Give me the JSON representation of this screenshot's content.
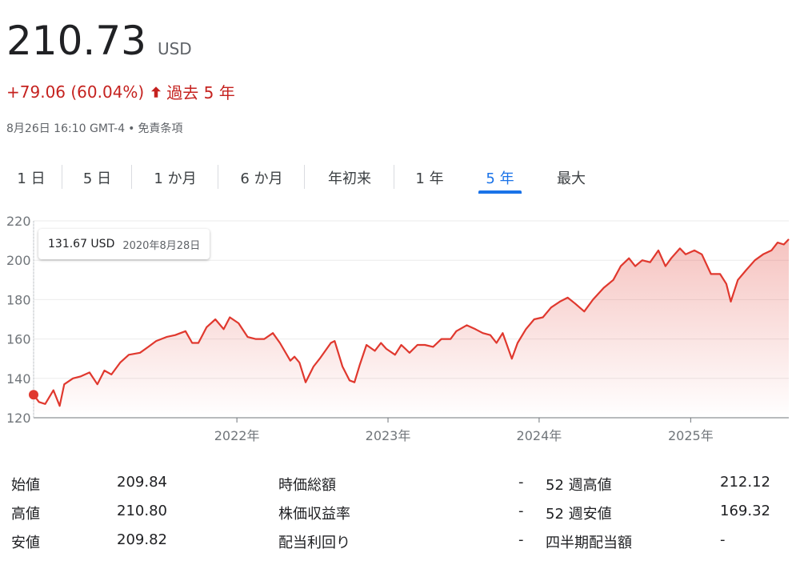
{
  "quote": {
    "price": "210.73",
    "currency": "USD",
    "change": "+79.06 (60.04%)",
    "period": "過去 5 年",
    "timestamp": "8月26日 16:10 GMT-4",
    "disclaimer": "免責条項"
  },
  "colors": {
    "accent": "#1a73e8",
    "negative_red": "#c5221f",
    "line": "#e0382e"
  },
  "tabs": [
    {
      "label": "1 日"
    },
    {
      "label": "5 日"
    },
    {
      "label": "1 か月"
    },
    {
      "label": "6 か月"
    },
    {
      "label": "年初来"
    },
    {
      "label": "1 年"
    },
    {
      "label": "5 年",
      "active": true
    },
    {
      "label": "最大"
    }
  ],
  "tooltip": {
    "value": "131.67 USD",
    "date": "2020年8月28日"
  },
  "chart_data": {
    "type": "area",
    "ylim": [
      120,
      220
    ],
    "yticks": [
      "220",
      "200",
      "180",
      "160",
      "140",
      "120"
    ],
    "xticks": [
      "2022年",
      "2023年",
      "2024年",
      "2025年"
    ],
    "grid": true,
    "series": [
      {
        "x": [
          "2020-08-28",
          "2020-09-10",
          "2020-09-25",
          "2020-10-15",
          "2020-10-30",
          "2020-11-10",
          "2020-12-01",
          "2020-12-20",
          "2021-01-10",
          "2021-01-29",
          "2021-02-15",
          "2021-03-04",
          "2021-03-25",
          "2021-04-15",
          "2021-05-12",
          "2021-06-01",
          "2021-06-20",
          "2021-07-15",
          "2021-08-05",
          "2021-08-30",
          "2021-09-15",
          "2021-09-30",
          "2021-10-20",
          "2021-11-10",
          "2021-11-30",
          "2021-12-15",
          "2022-01-05",
          "2022-01-27",
          "2022-02-15",
          "2022-03-08",
          "2022-03-29",
          "2022-04-15",
          "2022-05-10",
          "2022-05-20",
          "2022-06-01",
          "2022-06-16",
          "2022-07-05",
          "2022-07-20",
          "2022-08-16",
          "2022-08-25",
          "2022-09-13",
          "2022-09-30",
          "2022-10-12",
          "2022-10-25",
          "2022-11-10",
          "2022-11-30",
          "2022-12-15",
          "2022-12-28",
          "2023-01-18",
          "2023-02-02",
          "2023-02-22",
          "2023-03-13",
          "2023-03-31",
          "2023-04-20",
          "2023-05-10",
          "2023-06-01",
          "2023-06-15",
          "2023-07-10",
          "2023-07-31",
          "2023-08-18",
          "2023-09-05",
          "2023-09-20",
          "2023-10-05",
          "2023-10-27",
          "2023-11-10",
          "2023-11-30",
          "2023-12-20",
          "2024-01-10",
          "2024-01-30",
          "2024-02-20",
          "2024-03-10",
          "2024-03-28",
          "2024-04-19",
          "2024-05-10",
          "2024-06-05",
          "2024-06-28",
          "2024-07-16",
          "2024-08-05",
          "2024-08-20",
          "2024-09-06",
          "2024-09-25",
          "2024-10-15",
          "2024-11-01",
          "2024-11-15",
          "2024-12-06",
          "2024-12-20",
          "2025-01-10",
          "2025-01-28",
          "2025-02-19",
          "2025-03-13",
          "2025-03-28",
          "2025-04-08",
          "2025-04-25",
          "2025-05-15",
          "2025-06-05",
          "2025-06-25",
          "2025-07-15",
          "2025-07-30",
          "2025-08-14",
          "2025-08-26"
        ],
        "values": [
          131.7,
          128,
          127,
          134,
          126,
          137,
          140,
          141,
          143,
          137,
          144,
          142,
          148,
          152,
          153,
          156,
          159,
          161,
          162,
          164,
          158,
          158,
          166,
          170,
          165,
          171,
          168,
          161,
          160,
          160,
          163,
          158,
          149,
          151,
          148,
          138,
          146,
          150,
          158,
          159,
          146,
          139,
          138,
          147,
          157,
          154,
          158,
          155,
          152,
          157,
          153,
          157,
          157,
          156,
          160,
          160,
          164,
          167,
          165,
          163,
          162,
          158,
          163,
          150,
          158,
          165,
          170,
          171,
          176,
          179,
          181,
          178,
          174,
          180,
          186,
          190,
          197,
          201,
          197,
          200,
          199,
          205,
          197,
          201,
          206,
          203,
          205,
          203,
          193,
          193,
          188,
          179,
          190,
          195,
          200,
          203,
          205,
          209,
          208,
          210.7
        ]
      }
    ]
  },
  "stats": [
    [
      {
        "label": "始値",
        "value": "209.84"
      },
      {
        "label": "時価総額",
        "value": "-"
      },
      {
        "label": "52 週高値",
        "value": "212.12"
      }
    ],
    [
      {
        "label": "高値",
        "value": "210.80"
      },
      {
        "label": "株価収益率",
        "value": "-"
      },
      {
        "label": "52 週安値",
        "value": "169.32"
      }
    ],
    [
      {
        "label": "安値",
        "value": "209.82"
      },
      {
        "label": "配当利回り",
        "value": "-"
      },
      {
        "label": "四半期配当額",
        "value": "-"
      }
    ]
  ]
}
